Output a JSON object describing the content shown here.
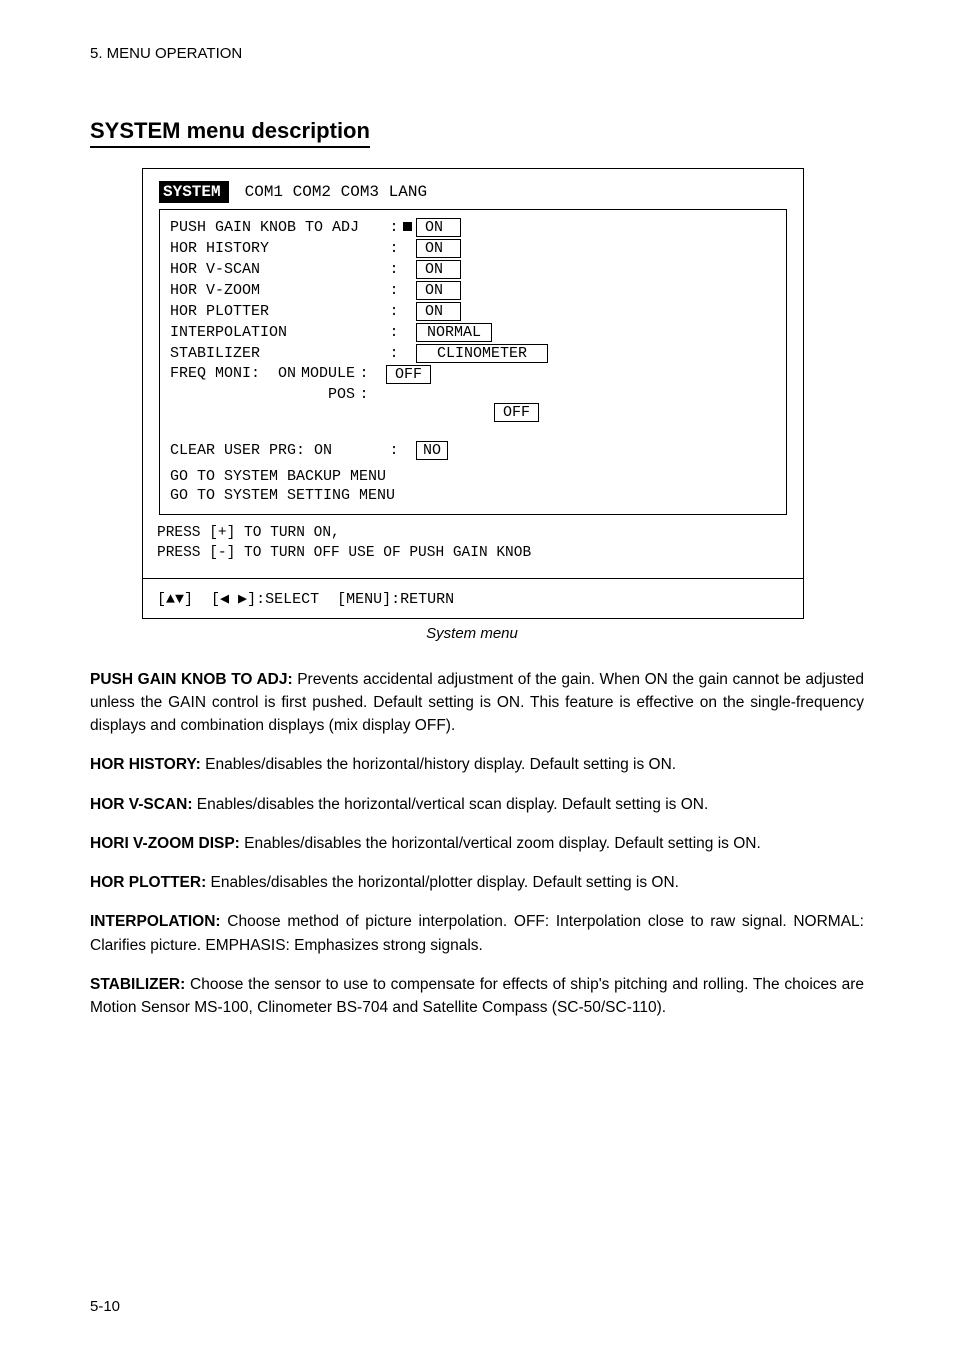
{
  "header": "5. MENU OPERATION",
  "section_title": "SYSTEM menu description",
  "tabs": {
    "active": "SYSTEM",
    "rest": "   COM1   COM2   COM3   LANG"
  },
  "rows": {
    "r1": {
      "label": "PUSH GAIN KNOB TO ADJ",
      "box": "ON "
    },
    "r2": {
      "label": "HOR HISTORY",
      "box": "ON "
    },
    "r3": {
      "label": "HOR V-SCAN",
      "box": "ON "
    },
    "r4": {
      "label": "HOR V-ZOOM",
      "box": "ON "
    },
    "r5": {
      "label": "HOR PLOTTER",
      "box": "ON "
    },
    "r6": {
      "label": "INTERPOLATION",
      "box": "NORMAL"
    },
    "r7": {
      "label": "STABILIZER",
      "box": "CLINOMETER"
    },
    "r8": {
      "label": "FREQ MONI:  ON",
      "prefix": "MODULE",
      "box": "OFF"
    },
    "r9a": {
      "label": "",
      "prefix": "POS",
      "box": "OFF"
    },
    "r9b": {
      "label": "CLEAR USER PRG: ON",
      "prefix": "",
      "box": "NO"
    },
    "r10": {
      "label": "GO TO SYSTEM BACKUP MENU"
    },
    "r11": {
      "label": "GO TO SYSTEM SETTING MENU"
    }
  },
  "foot": {
    "l1": "PRESS [+] TO TURN ON,",
    "l2": "PRESS [-] TO TURN OFF USE OF PUSH GAIN KNOB"
  },
  "hint": "[▲▼]  [◀ ▶]:SELECT  [MENU]:RETURN",
  "caption": "System menu",
  "desc": {
    "d1_bold": "PUSH GAIN KNOB TO ADJ:",
    "d1": " Prevents accidental adjustment of the gain. When ON the gain cannot be adjusted unless the GAIN control is first pushed. Default setting is ON. This feature is effective on the single-frequency displays and combination displays (mix display OFF).",
    "d2_bold": "HOR HISTORY:",
    "d2": " Enables/disables the horizontal/history display. Default setting is ON.",
    "d3_bold": "HOR V-SCAN:",
    "d3": " Enables/disables the horizontal/vertical scan display. Default setting is ON.",
    "d4_bold": "HORI V-ZOOM DISP:",
    "d4": " Enables/disables the horizontal/vertical zoom display. Default setting is ON.",
    "d5_bold": "HOR PLOTTER:",
    "d5": " Enables/disables the horizontal/plotter display. Default setting is ON.",
    "d6_bold": "INTERPOLATION:",
    "d6": " Choose method of picture interpolation. OFF: Interpolation close to raw signal. NORMAL: Clarifies picture. EMPHASIS: Emphasizes strong signals.",
    "d7_bold": "STABILIZER:",
    "d7": " Choose the sensor to use to compensate for effects of ship's pitching and rolling. The choices are Motion Sensor MS-100, Clinometer BS-704 and Satellite Compass (SC-50/SC-110)."
  },
  "pagenum": "5-10"
}
